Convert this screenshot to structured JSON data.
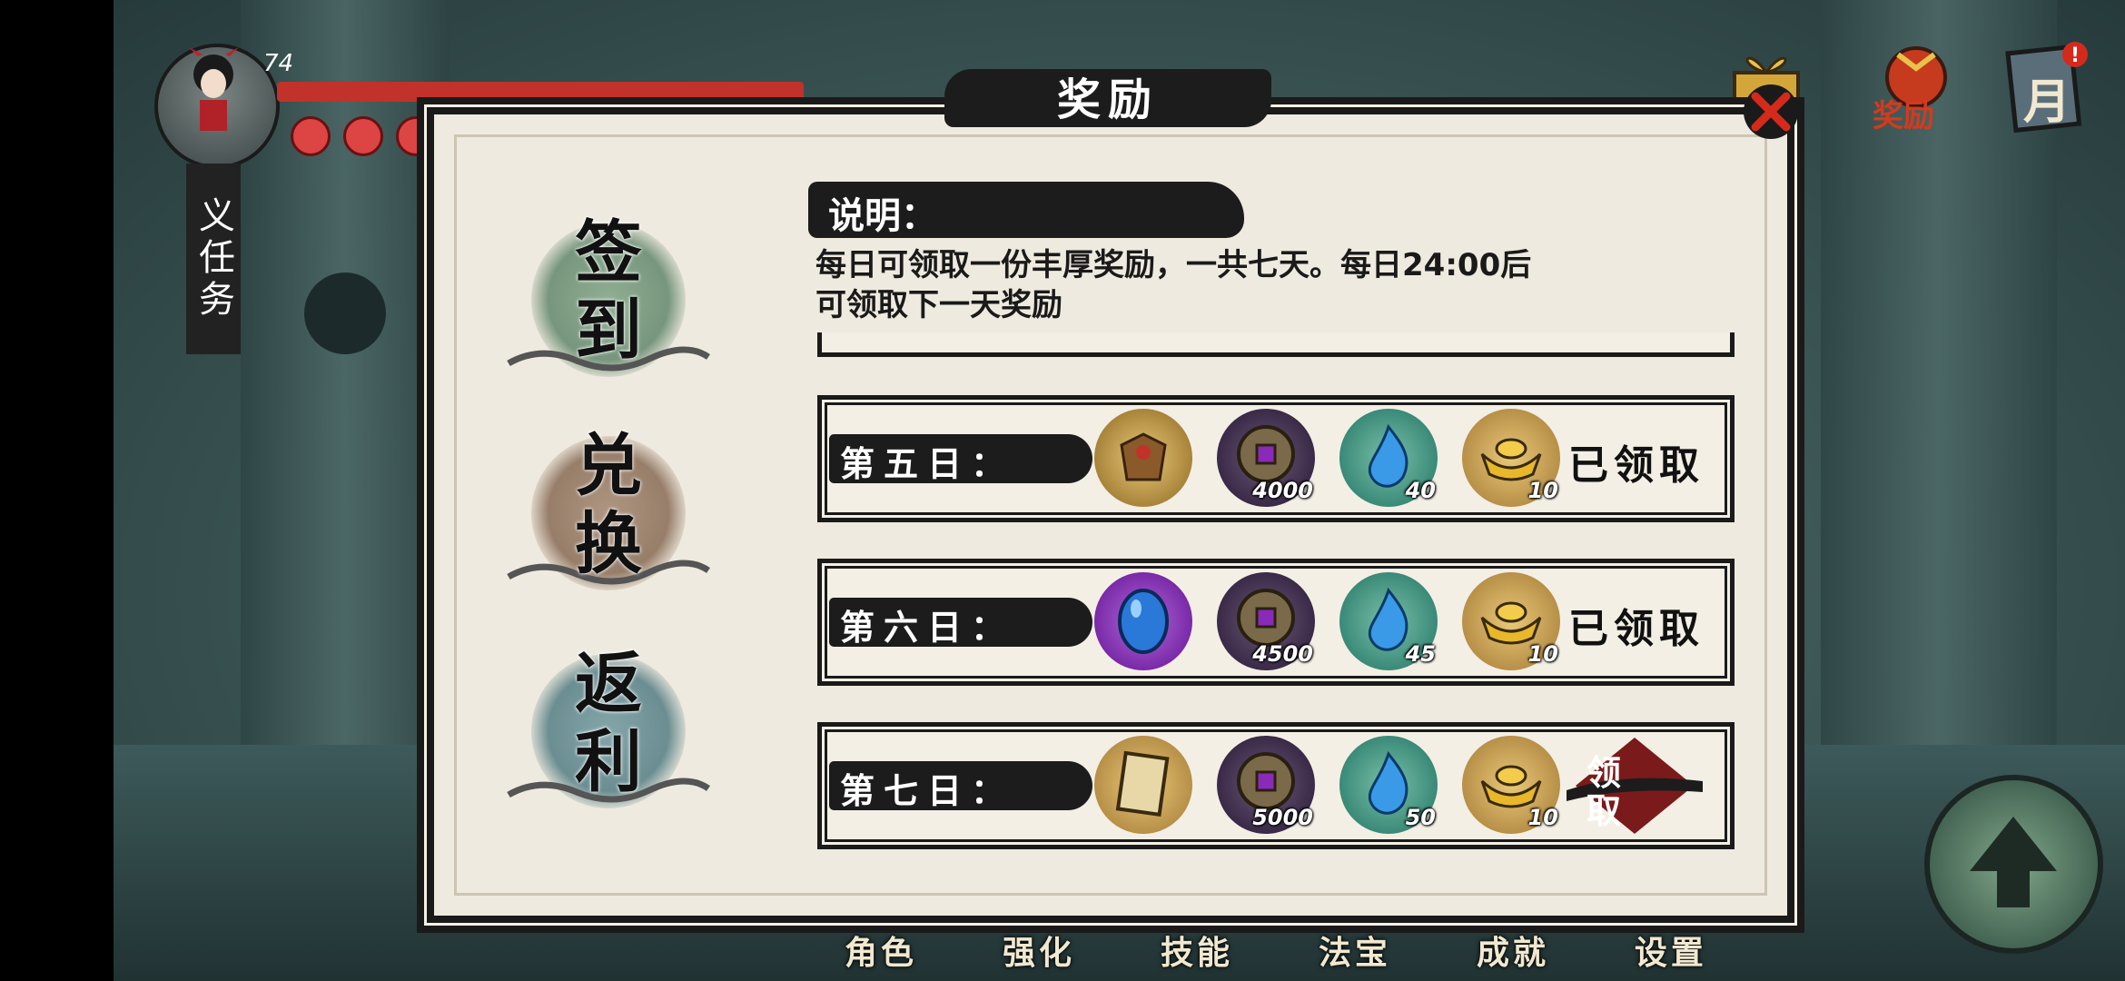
{
  "hud": {
    "level": "74",
    "quest_tag": "义任务",
    "top_right": {
      "reward_label": "奖励",
      "month_label": "月"
    }
  },
  "modal": {
    "title": "奖励",
    "tabs": [
      {
        "label_top": "签",
        "label_bottom": "到",
        "color": "#4f7a5c"
      },
      {
        "label_top": "兑",
        "label_bottom": "换",
        "color": "#7a5a42"
      },
      {
        "label_top": "返",
        "label_bottom": "利",
        "color": "#3f6f78"
      }
    ],
    "explanation": {
      "title": "说明：",
      "text_line1": "每日可领取一份丰厚奖励，一共七天。每日24:00后",
      "text_line2": "可领取下一天奖励"
    },
    "days": [
      {
        "label": "第五日：",
        "items": [
          {
            "icon": "armor-icon",
            "count": ""
          },
          {
            "icon": "coin-icon",
            "count": "4000"
          },
          {
            "icon": "blue-flame-icon",
            "count": "40"
          },
          {
            "icon": "gold-ingot-icon",
            "count": "10"
          }
        ],
        "status": "已领取",
        "claimed": true
      },
      {
        "label": "第六日：",
        "items": [
          {
            "icon": "blue-gem-icon",
            "count": ""
          },
          {
            "icon": "coin-icon",
            "count": "4500"
          },
          {
            "icon": "blue-flame-icon",
            "count": "45"
          },
          {
            "icon": "gold-ingot-icon",
            "count": "10"
          }
        ],
        "status": "已领取",
        "claimed": true
      },
      {
        "label": "第七日：",
        "items": [
          {
            "icon": "book-icon",
            "count": ""
          },
          {
            "icon": "coin-icon",
            "count": "5000"
          },
          {
            "icon": "blue-flame-icon",
            "count": "50"
          },
          {
            "icon": "gold-ingot-icon",
            "count": "10"
          }
        ],
        "status": "领取",
        "claimed": false
      }
    ]
  },
  "bottom_nav": [
    {
      "label": "角色"
    },
    {
      "label": "强化"
    },
    {
      "label": "技能"
    },
    {
      "label": "法宝"
    },
    {
      "label": "成就"
    },
    {
      "label": "设置"
    }
  ]
}
